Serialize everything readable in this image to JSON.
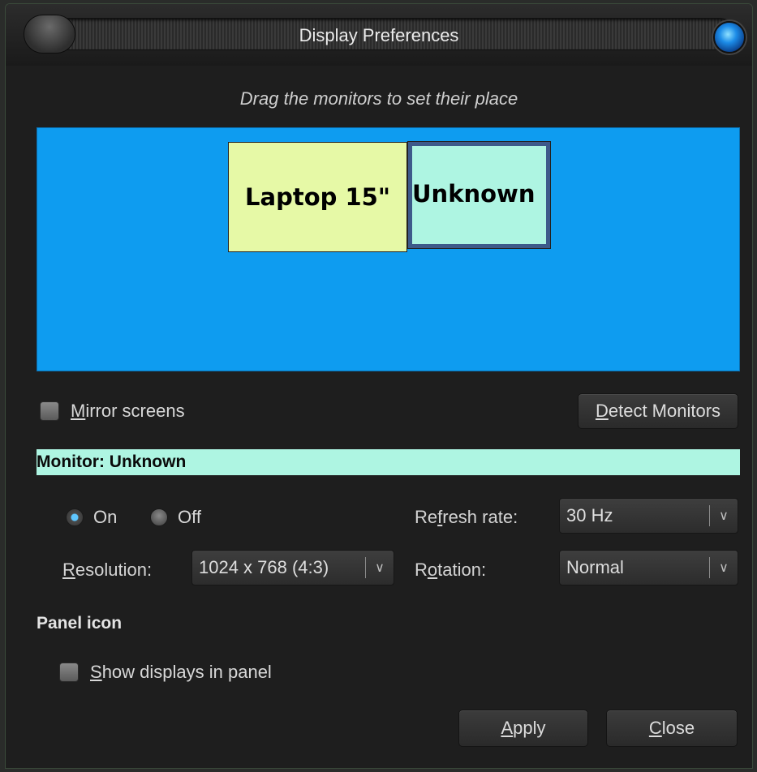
{
  "window": {
    "title": "Display Preferences"
  },
  "hint": "Drag the monitors to set their place",
  "monitors": [
    {
      "label": "Laptop 15\"",
      "color": "#e6f9a6"
    },
    {
      "label": "Unknown",
      "color": "#aef5e2",
      "selected": true
    }
  ],
  "canvas_color": "#0e9cf0",
  "mirror": {
    "label_u": "M",
    "label_rest": "irror screens",
    "checked": false
  },
  "detect": {
    "label_u": "D",
    "label_rest": "etect Monitors"
  },
  "monitor_header": "Monitor: Unknown",
  "power": {
    "on_label": "On",
    "off_label": "Off",
    "selected": "On"
  },
  "refresh": {
    "label_a": "Re",
    "label_u": "f",
    "label_b": "resh rate:",
    "value": "30 Hz"
  },
  "resolution": {
    "label_u": "R",
    "label_rest": "esolution:",
    "value": "1024 x 768 (4:3)"
  },
  "rotation": {
    "label_a": "R",
    "label_u": "o",
    "label_b": "tation:",
    "value": "Normal"
  },
  "panel_icon": {
    "section_title": "Panel icon",
    "show_u": "S",
    "show_rest": "how displays in panel",
    "checked": false
  },
  "buttons": {
    "apply_u": "A",
    "apply_rest": "pply",
    "close_u": "C",
    "close_rest": "lose"
  }
}
